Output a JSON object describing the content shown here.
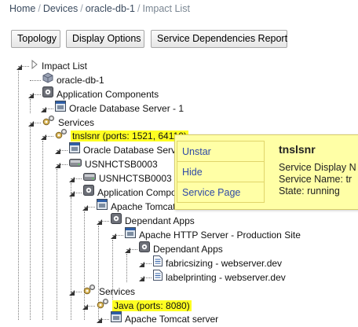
{
  "breadcrumb": {
    "items": [
      "Home",
      "Devices",
      "oracle-db-1"
    ],
    "separator": "/",
    "current": "Impact List"
  },
  "toolbar": {
    "topology_label": "Topology",
    "display_options_label": "Display Options",
    "service_dependencies_label": "Service Dependencies Report"
  },
  "tree": {
    "rows": [
      {
        "label": "Impact List",
        "icon": "arrow-right-icon"
      },
      {
        "label": "oracle-db-1",
        "icon": "cube-icon"
      },
      {
        "label": "Application Components",
        "icon": "gear-box-icon"
      },
      {
        "label": "Oracle Database Server - 1",
        "icon": "window-icon"
      },
      {
        "label": "Services",
        "icon": "gears-icon"
      },
      {
        "label": "tnslsnr (ports: 1521, 64110)",
        "icon": "gears-icon",
        "highlighted": true
      },
      {
        "label": "Oracle Database Server - 1",
        "icon": "window-icon"
      },
      {
        "label": "USNHCTSB0003",
        "icon": "drive-icon"
      },
      {
        "label": "USNHCTSB0003",
        "icon": "drive-icon"
      },
      {
        "label": "Application Components",
        "icon": "gear-box-icon"
      },
      {
        "label": "Apache Tomcat server",
        "icon": "window-icon"
      },
      {
        "label": "Dependant Apps",
        "icon": "gear-box-icon"
      },
      {
        "label": "Apache HTTP Server - Production Site",
        "icon": "window-icon"
      },
      {
        "label": "Dependant Apps",
        "icon": "gear-box-icon"
      },
      {
        "label": "fabricsizing - webserver.dev",
        "icon": "document-icon"
      },
      {
        "label": "labelprinting - webserver.dev",
        "icon": "document-icon"
      },
      {
        "label": "Services",
        "icon": "gears-icon"
      },
      {
        "label": "Java (ports: 8080)",
        "icon": "gears-icon",
        "highlighted": true
      },
      {
        "label": "Apache Tomcat server",
        "icon": "window-icon"
      }
    ]
  },
  "popup": {
    "menu": [
      "Unstar",
      "Hide",
      "Service Page"
    ],
    "title": "tnslsnr",
    "info": [
      "Service Display N",
      "Service Name: tr",
      "State: running"
    ]
  },
  "colors": {
    "highlight": "#ffff22",
    "popup_bg": "#ffffa6",
    "link": "#2f4aa6"
  }
}
